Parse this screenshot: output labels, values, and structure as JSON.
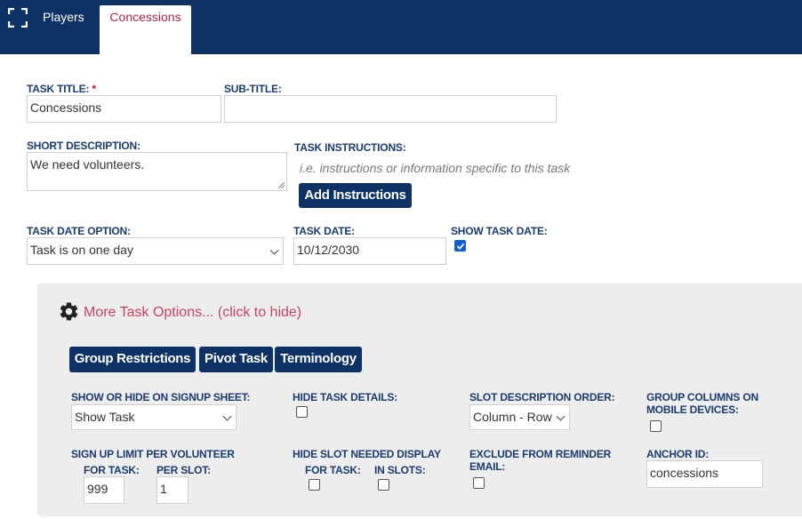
{
  "tabs": {
    "players": "Players",
    "concessions": "Concessions"
  },
  "form": {
    "task_title": {
      "label": "TASK TITLE:",
      "required_mark": "*",
      "value": "Concessions"
    },
    "sub_title": {
      "label": "SUB-TITLE:",
      "value": ""
    },
    "short_description": {
      "label": "SHORT DESCRIPTION:",
      "value": "We need volunteers."
    },
    "task_instructions": {
      "label": "TASK INSTRUCTIONS:",
      "placeholder": "i.e. instructions or information specific to this task",
      "add_button": "Add Instructions"
    },
    "task_date_option": {
      "label": "TASK DATE OPTION:",
      "value": "Task is on one day"
    },
    "task_date": {
      "label": "TASK DATE:",
      "value": "10/12/2030"
    },
    "show_task_date": {
      "label": "SHOW TASK DATE:",
      "checked": true
    }
  },
  "options": {
    "toggle_label": "More Task Options... (click to hide)",
    "buttons": {
      "group_restrictions": "Group Restrictions",
      "pivot_task": "Pivot Task",
      "terminology": "Terminology"
    },
    "show_hide": {
      "label": "SHOW OR HIDE ON SIGNUP SHEET:",
      "value": "Show Task"
    },
    "hide_details": {
      "label": "HIDE TASK DETAILS:",
      "checked": false
    },
    "slot_order": {
      "label": "SLOT DESCRIPTION ORDER:",
      "value": "Column - Row"
    },
    "group_columns": {
      "label_line1": "GROUP COLUMNS ON",
      "label_line2": "MOBILE DEVICES:",
      "checked": false
    },
    "signup_limit": {
      "label": "SIGN UP LIMIT PER VOLUNTEER",
      "for_task_label": "FOR TASK:",
      "for_task_value": "999",
      "per_slot_label": "PER SLOT:",
      "per_slot_value": "1"
    },
    "hide_slot_needed": {
      "label": "HIDE SLOT NEEDED DISPLAY",
      "for_task_label": "FOR TASK:",
      "in_slots_label": "IN SLOTS:",
      "for_task_checked": false,
      "in_slots_checked": false
    },
    "exclude_reminder": {
      "label_line1": "EXCLUDE FROM REMINDER",
      "label_line2": "EMAIL:",
      "checked": false
    },
    "anchor_id": {
      "label": "ANCHOR ID:",
      "value": "concessions"
    }
  },
  "colors": {
    "navy": "#0e3166",
    "label": "#1b3c6e",
    "accent": "#b4234a",
    "link": "#c94463",
    "panel": "#ededed",
    "checkbox": "#0f5fd6"
  }
}
